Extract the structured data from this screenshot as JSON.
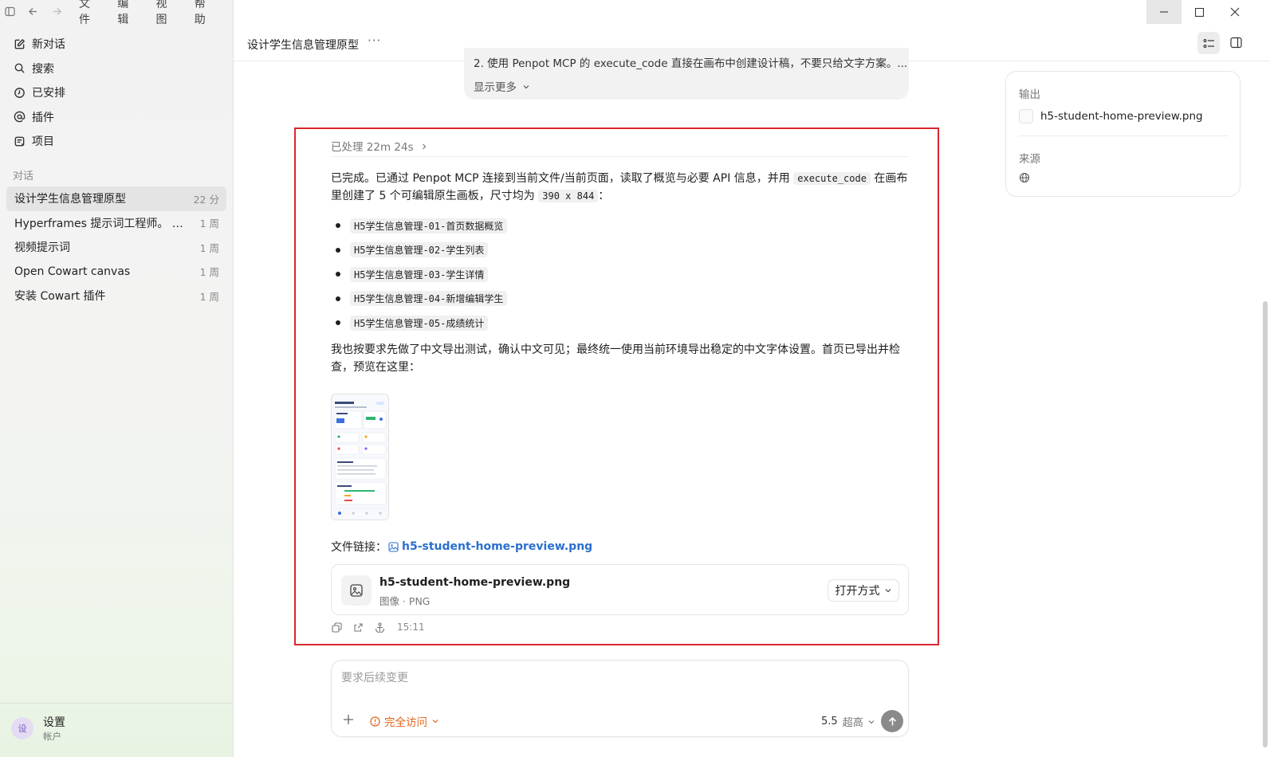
{
  "window": {
    "menu": [
      "文件",
      "编辑",
      "视图",
      "帮助"
    ]
  },
  "sidebar": {
    "nav": [
      {
        "label": "新对话",
        "icon": "edit-icon"
      },
      {
        "label": "搜索",
        "icon": "search-icon"
      },
      {
        "label": "已安排",
        "icon": "clock-icon"
      },
      {
        "label": "插件",
        "icon": "at-icon"
      },
      {
        "label": "项目",
        "icon": "folder-icon"
      }
    ],
    "section_label": "对话",
    "conversations": [
      {
        "title": "设计学生信息管理原型",
        "age": "22 分"
      },
      {
        "title": "Hyperframes 提示词工程师。 我要...",
        "age": "1 周"
      },
      {
        "title": "视频提示词",
        "age": "1 周"
      },
      {
        "title": "Open Cowart canvas",
        "age": "1 周"
      },
      {
        "title": "安装 Cowart 插件",
        "age": "1 周"
      }
    ],
    "footer": {
      "avatar": "设",
      "name": "设置",
      "sub": "帐户"
    }
  },
  "header": {
    "title": "设计学生信息管理原型",
    "more": "···"
  },
  "user_message": {
    "text": "2. 使用 Penpot MCP 的 execute_code 直接在画布中创建设计稿，不要只给文字方案。...",
    "show_more": "显示更多"
  },
  "assistant": {
    "processed": "已处理 22m 24s",
    "intro_1": "已完成。已通过 Penpot MCP 连接到当前文件/当前页面，读取了概览与必要 API 信息，并用",
    "intro_code": "execute_code",
    "intro_2": "在画布里创建了 5 个可编辑原生画板，尺寸均为",
    "size_code": "390 x 844",
    "intro_3": "：",
    "boards": [
      "H5学生信息管理-01-首页数据概览",
      "H5学生信息管理-02-学生列表",
      "H5学生信息管理-03-学生详情",
      "H5学生信息管理-04-新增编辑学生",
      "H5学生信息管理-05-成绩统计"
    ],
    "para2": "我也按要求先做了中文导出测试，确认中文可见；最终统一使用当前环境导出稳定的中文字体设置。首页已导出并检查，预览在这里：",
    "link_label": "文件链接：",
    "link_text": "h5-student-home-preview.png",
    "file": {
      "name": "h5-student-home-preview.png",
      "type": "图像 · PNG",
      "open_label": "打开方式"
    },
    "time": "15:11"
  },
  "composer": {
    "placeholder": "要求后续变更",
    "access": "完全访问",
    "model": "5.5",
    "quality": "超高"
  },
  "side_panel": {
    "output_label": "输出",
    "output_file": "h5-student-home-preview.png",
    "source_label": "来源"
  },
  "colors": {
    "highlight": "#d9262c",
    "link": "#2a6fcf",
    "access": "#e0641b",
    "avatar_bg": "#e4dcf3"
  }
}
